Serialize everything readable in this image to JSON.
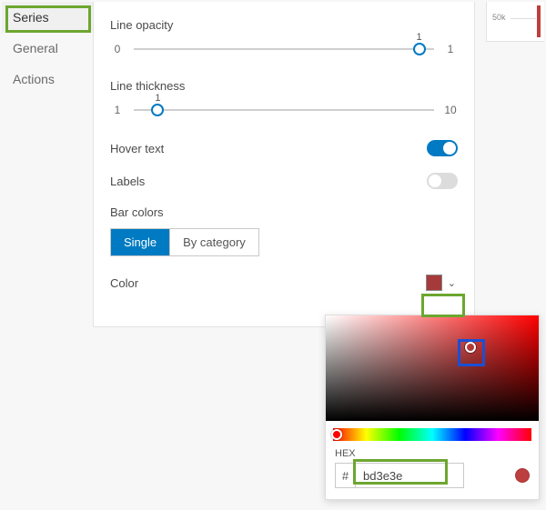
{
  "tabs": {
    "series": "Series",
    "general": "General",
    "actions": "Actions",
    "active": "series"
  },
  "lineOpacity": {
    "label": "Line opacity",
    "min": "0",
    "max": "1",
    "value": "1",
    "pct": 95
  },
  "lineThickness": {
    "label": "Line thickness",
    "min": "1",
    "max": "10",
    "value": "1",
    "pct": 8
  },
  "hoverText": {
    "label": "Hover text",
    "on": true
  },
  "labels": {
    "label": "Labels",
    "on": false
  },
  "barColors": {
    "label": "Bar colors",
    "single": "Single",
    "byCategory": "By category",
    "active": "single"
  },
  "color": {
    "label": "Color",
    "hex": "bd3e3e",
    "swatchCss": "#a63a3a"
  },
  "picker": {
    "hexLabel": "HEX",
    "hash": "#",
    "hex": "bd3e3e",
    "svX": 68,
    "svY": 30,
    "hueX": 2,
    "previewCss": "#bd3e3e"
  },
  "mini": {
    "tick": "50k"
  }
}
